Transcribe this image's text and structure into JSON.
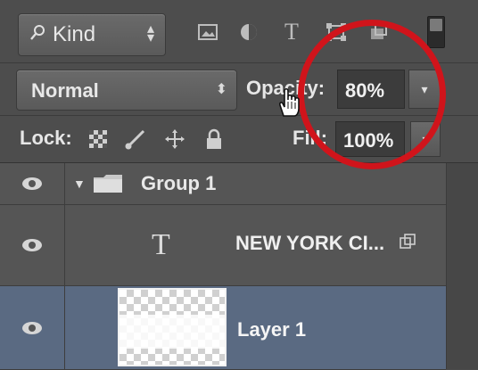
{
  "filter": {
    "kind_label": "Kind",
    "icons": [
      "image-filter-icon",
      "adjustment-filter-icon",
      "type-filter-icon",
      "shape-filter-icon",
      "smart-object-filter-icon"
    ]
  },
  "blend": {
    "mode": "Normal",
    "opacity_label": "Opacity:",
    "opacity_value": "80%"
  },
  "lock": {
    "label": "Lock:",
    "fill_label": "Fill:",
    "fill_value": "100%"
  },
  "layers": [
    {
      "type": "group",
      "name": "Group 1"
    },
    {
      "type": "text",
      "name": "NEW YORK CI...",
      "thumb_glyph": "T"
    },
    {
      "type": "pixel",
      "name": "Layer 1",
      "selected": true
    }
  ],
  "colors": {
    "annotation": "#d0141b",
    "selected_row": "#5a6a82"
  }
}
